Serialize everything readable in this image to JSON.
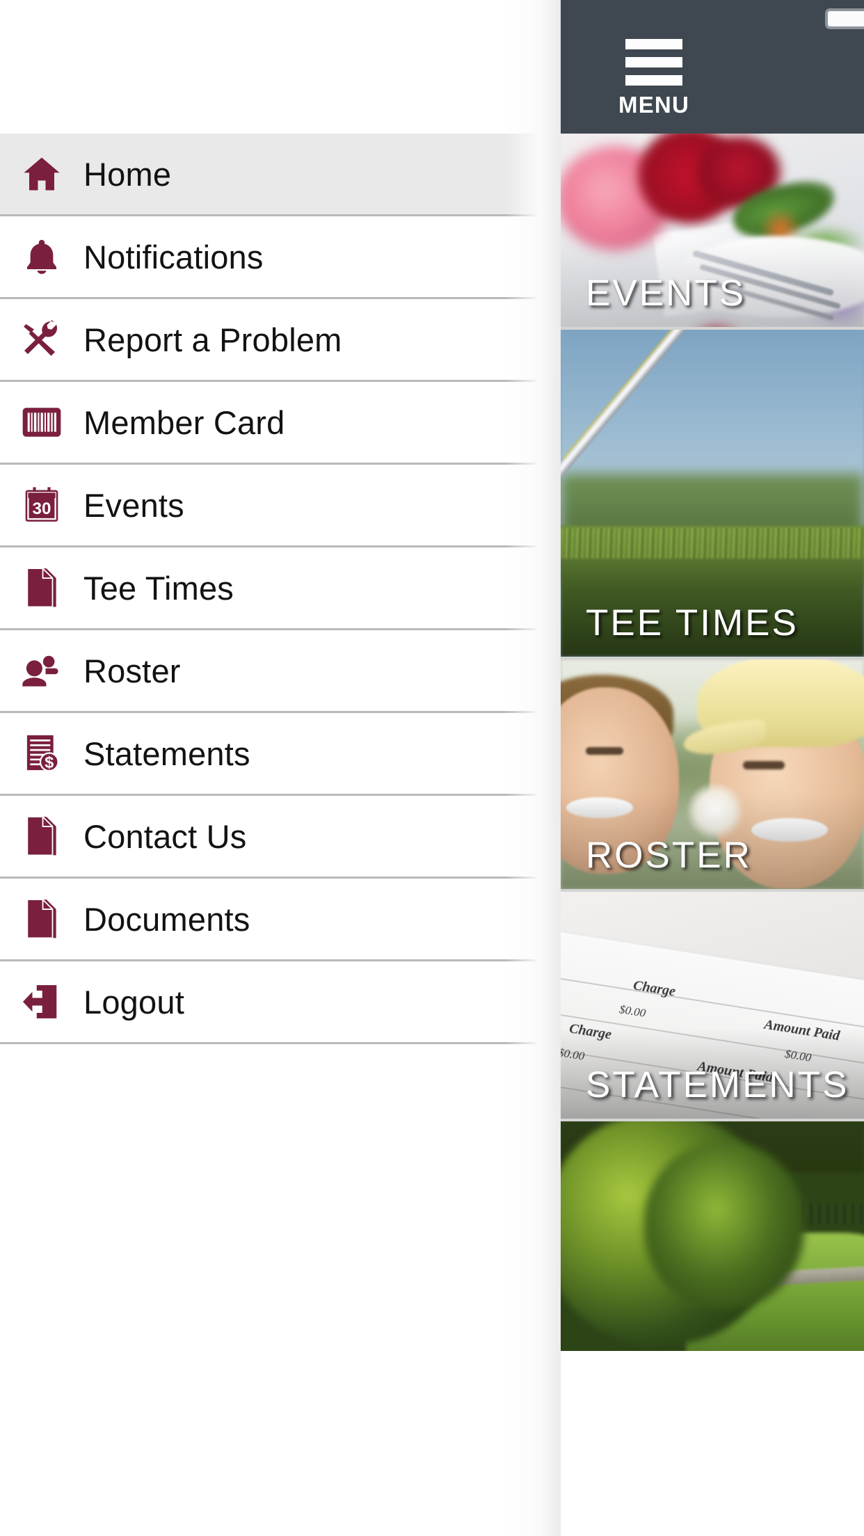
{
  "app": {
    "menu_label": "MENU",
    "accent_color": "#7a1f3d",
    "appbar_color": "#3f4750",
    "active_item_bg": "#e9e9e9"
  },
  "status_bar": {
    "battery_icon": "battery-icon"
  },
  "drawer": {
    "items": [
      {
        "label": "Home",
        "icon": "home-icon",
        "active": true
      },
      {
        "label": "Notifications",
        "icon": "bell-icon",
        "active": false
      },
      {
        "label": "Report a Problem",
        "icon": "tools-icon",
        "active": false
      },
      {
        "label": "Member Card",
        "icon": "barcode-icon",
        "active": false
      },
      {
        "label": "Events",
        "icon": "calendar-icon",
        "active": false,
        "badge": "30"
      },
      {
        "label": "Tee Times",
        "icon": "document-icon",
        "active": false
      },
      {
        "label": "Roster",
        "icon": "people-icon",
        "active": false
      },
      {
        "label": "Statements",
        "icon": "invoice-icon",
        "active": false
      },
      {
        "label": "Contact Us",
        "icon": "document-icon",
        "active": false
      },
      {
        "label": "Documents",
        "icon": "document-icon",
        "active": false
      },
      {
        "label": "Logout",
        "icon": "logout-icon",
        "active": false
      }
    ]
  },
  "tiles": [
    {
      "label": "EVENTS",
      "art": "events-photo"
    },
    {
      "label": "TEE TIMES",
      "art": "tee-times-photo"
    },
    {
      "label": "ROSTER",
      "art": "roster-photo"
    },
    {
      "label": "STATEMENTS",
      "art": "statements-photo"
    },
    {
      "label": "",
      "art": "golf-course-photo"
    }
  ],
  "statement_photo_text": {
    "charge_1": "Charge",
    "amount_1": "$0.00",
    "charge_2": "Charge",
    "amount_2": "$0.00",
    "amount_paid_1": "Amount Paid",
    "amount_paid_2": "$0.00",
    "amount_paid_3": "Amount Paid"
  }
}
